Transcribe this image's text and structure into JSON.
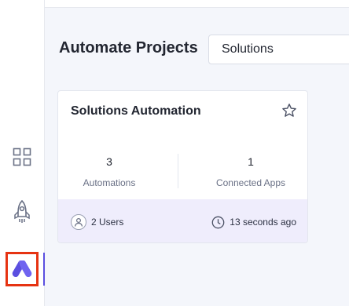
{
  "header": {
    "title": "Automate Projects",
    "project_select_value": "Solutions"
  },
  "sidebar": {
    "items": [
      {
        "name": "dashboard",
        "icon": "grid-icon"
      },
      {
        "name": "launch",
        "icon": "rocket-icon"
      },
      {
        "name": "automate",
        "icon": "automate-logo-icon",
        "active": true
      }
    ]
  },
  "project_card": {
    "title": "Solutions Automation",
    "stats": [
      {
        "value": "3",
        "label": "Automations"
      },
      {
        "value": "1",
        "label": "Connected Apps"
      }
    ],
    "users_label": "2 Users",
    "updated_label": "13 seconds ago"
  },
  "colors": {
    "accent": "#5b4fe0",
    "card_footer": "#efedfc",
    "focus_outline": "#e63312"
  }
}
